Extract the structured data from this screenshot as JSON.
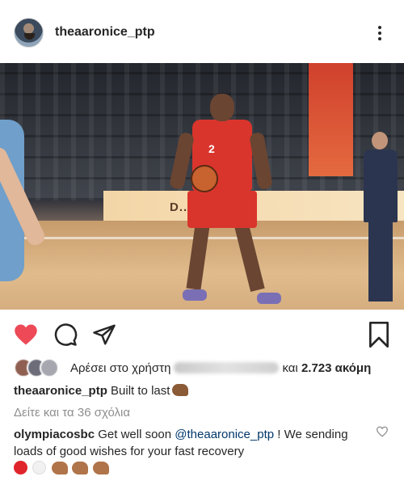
{
  "post": {
    "author": "theaaronice_ptp",
    "more_icon": "more-vertical-icon",
    "photo": {
      "adboard_text": "D...UE #2",
      "player_number": "2"
    }
  },
  "actions": {
    "like_icon": "heart-filled-icon",
    "comment_icon": "comment-icon",
    "share_icon": "share-icon",
    "save_icon": "bookmark-icon",
    "like_color": "#ed4956"
  },
  "likes": {
    "prefix": "Αρέσει στο χρήστη",
    "and": "και",
    "others": "2.723 ακόμη"
  },
  "caption": {
    "username": "theaaronice_ptp",
    "text": "Built to last"
  },
  "view_comments": "Δείτε και τα 36 σχόλια",
  "comment": {
    "username": "olympiacosbc",
    "text_before": "Get well soon",
    "mention": "@theaaronice_ptp",
    "text_after": "! We sending loads of good wishes for your fast recovery"
  },
  "colors": {
    "text": "#262626",
    "muted": "#8e8e8e",
    "mention": "#00376b",
    "red_circle": "#e0242b",
    "white_circle": "#f1f1f1"
  }
}
